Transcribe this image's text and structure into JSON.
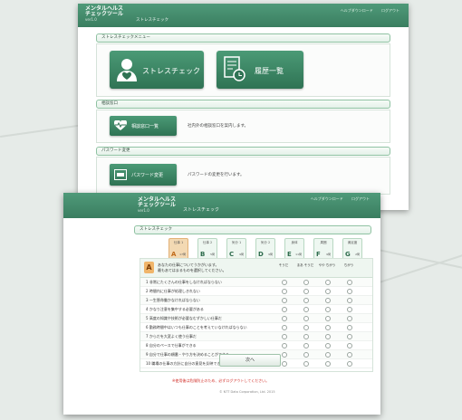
{
  "app": {
    "brand_line1": "メンタルヘルス",
    "brand_line2": "チェックツール",
    "version": "ver1.0",
    "header_links": [
      "ヘルプダウンロード",
      "ログアウト"
    ]
  },
  "menu_screen": {
    "breadcrumb": "ストレスチェック",
    "section_stress_menu": "ストレスチェックメニュー",
    "stress_check_button": "ストレスチェック",
    "history_button": "履歴一覧",
    "section_consult": "相談窓口",
    "consult_button": "相談窓口一覧",
    "consult_desc": "社内外の相談窓口を案内します。",
    "section_password": "パスワード変更",
    "password_button": "パスワード変更",
    "password_desc": "パスワードの変更を行います。"
  },
  "check_screen": {
    "breadcrumb": "ストレスチェック",
    "section_title": "ストレスチェック",
    "steps": [
      {
        "title": "仕事 1",
        "letter": "A",
        "time": "17問",
        "active": true
      },
      {
        "title": "仕事 2",
        "letter": "B",
        "time": "5問",
        "active": false
      },
      {
        "title": "気分 1",
        "letter": "C",
        "time": "9問",
        "active": false
      },
      {
        "title": "気分 2",
        "letter": "D",
        "time": "9問",
        "active": false
      },
      {
        "title": "身体",
        "letter": "E",
        "time": "11問",
        "active": false
      },
      {
        "title": "周囲",
        "letter": "F",
        "time": "9問",
        "active": false
      },
      {
        "title": "満足度",
        "letter": "G",
        "time": "2問",
        "active": false
      }
    ],
    "badge": "A",
    "intro_line1": "あなたの仕事についてうかがいます。",
    "intro_line2": "最もあてはまるものを選択してください。",
    "columns": [
      "そうだ",
      "まあ そうだ",
      "やや ちがう",
      "ちがう"
    ],
    "questions": [
      "1  非常にたくさんの仕事をしなければならない",
      "2  時間内に仕事が処理しきれない",
      "3  一生懸命働かなければならない",
      "4  かなり注意を集中する必要がある",
      "5  高度の知識や技術が必要なむずかしい仕事だ",
      "6  勤務時間中はいつも仕事のことを考えていなければならない",
      "7  からだを大変よく使う仕事だ",
      "8  自分のペースで仕事ができる",
      "9  自分で仕事の順番・やり方を決めることができる",
      "10  職場の仕事の方針に自分の意見を反映できる"
    ],
    "next_button": "次へ",
    "notice": "※使用後は危険防止のため、必ずログアウトしてください。",
    "copyright": "© NTT Data Corporation, Ltd. 2015"
  }
}
